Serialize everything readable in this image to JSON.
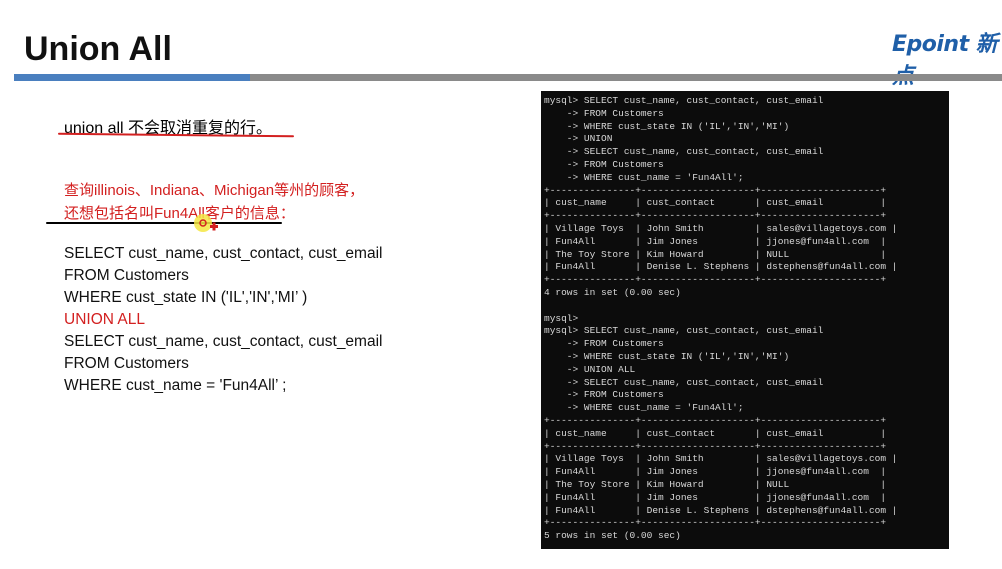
{
  "slide": {
    "title": "Union All",
    "logo_text": "Epoint 新点"
  },
  "notes": {
    "note1": "union all 不会取消重复的行。",
    "note2_line1": "查询illinois、Indiana、Michigan等州的顾客，",
    "note2_line2": "还想包括名叫Fun4All客户的信息："
  },
  "code_lines": [
    {
      "text": "SELECT cust_name, cust_contact, cust_email",
      "highlight": false
    },
    {
      "text": "FROM Customers",
      "highlight": false
    },
    {
      "text": "WHERE cust_state IN ('IL','IN','MI’ )",
      "highlight": false
    },
    {
      "text": "UNION ALL",
      "highlight": true
    },
    {
      "text": "SELECT cust_name, cust_contact, cust_email",
      "highlight": false
    },
    {
      "text": "FROM Customers",
      "highlight": false
    },
    {
      "text": "WHERE cust_name = 'Fun4All’ ;",
      "highlight": false
    }
  ],
  "terminal_lines": [
    "mysql> SELECT cust_name, cust_contact, cust_email",
    "    -> FROM Customers",
    "    -> WHERE cust_state IN ('IL','IN','MI')",
    "    -> UNION",
    "    -> SELECT cust_name, cust_contact, cust_email",
    "    -> FROM Customers",
    "    -> WHERE cust_name = 'Fun4All';",
    "+---------------+--------------------+---------------------+",
    "| cust_name     | cust_contact       | cust_email          |",
    "+---------------+--------------------+---------------------+",
    "| Village Toys  | John Smith         | sales@villagetoys.com |",
    "| Fun4All       | Jim Jones          | jjones@fun4all.com  |",
    "| The Toy Store | Kim Howard         | NULL                |",
    "| Fun4All       | Denise L. Stephens | dstephens@fun4all.com |",
    "+---------------+--------------------+---------------------+",
    "4 rows in set (0.00 sec)",
    "",
    "mysql>",
    "mysql> SELECT cust_name, cust_contact, cust_email",
    "    -> FROM Customers",
    "    -> WHERE cust_state IN ('IL','IN','MI')",
    "    -> UNION ALL",
    "    -> SELECT cust_name, cust_contact, cust_email",
    "    -> FROM Customers",
    "    -> WHERE cust_name = 'Fun4All';",
    "+---------------+--------------------+---------------------+",
    "| cust_name     | cust_contact       | cust_email          |",
    "+---------------+--------------------+---------------------+",
    "| Village Toys  | John Smith         | sales@villagetoys.com |",
    "| Fun4All       | Jim Jones          | jjones@fun4all.com  |",
    "| The Toy Store | Kim Howard         | NULL                |",
    "| Fun4All       | Jim Jones          | jjones@fun4all.com  |",
    "| Fun4All       | Denise L. Stephens | dstephens@fun4all.com |",
    "+---------------+--------------------+---------------------+",
    "5 rows in set (0.00 sec)"
  ],
  "colors": {
    "accent_red": "#d32020",
    "logo_blue": "#1f5fa8",
    "rule_blue": "#4a7fbf",
    "terminal_bg": "#0c0c0c"
  }
}
